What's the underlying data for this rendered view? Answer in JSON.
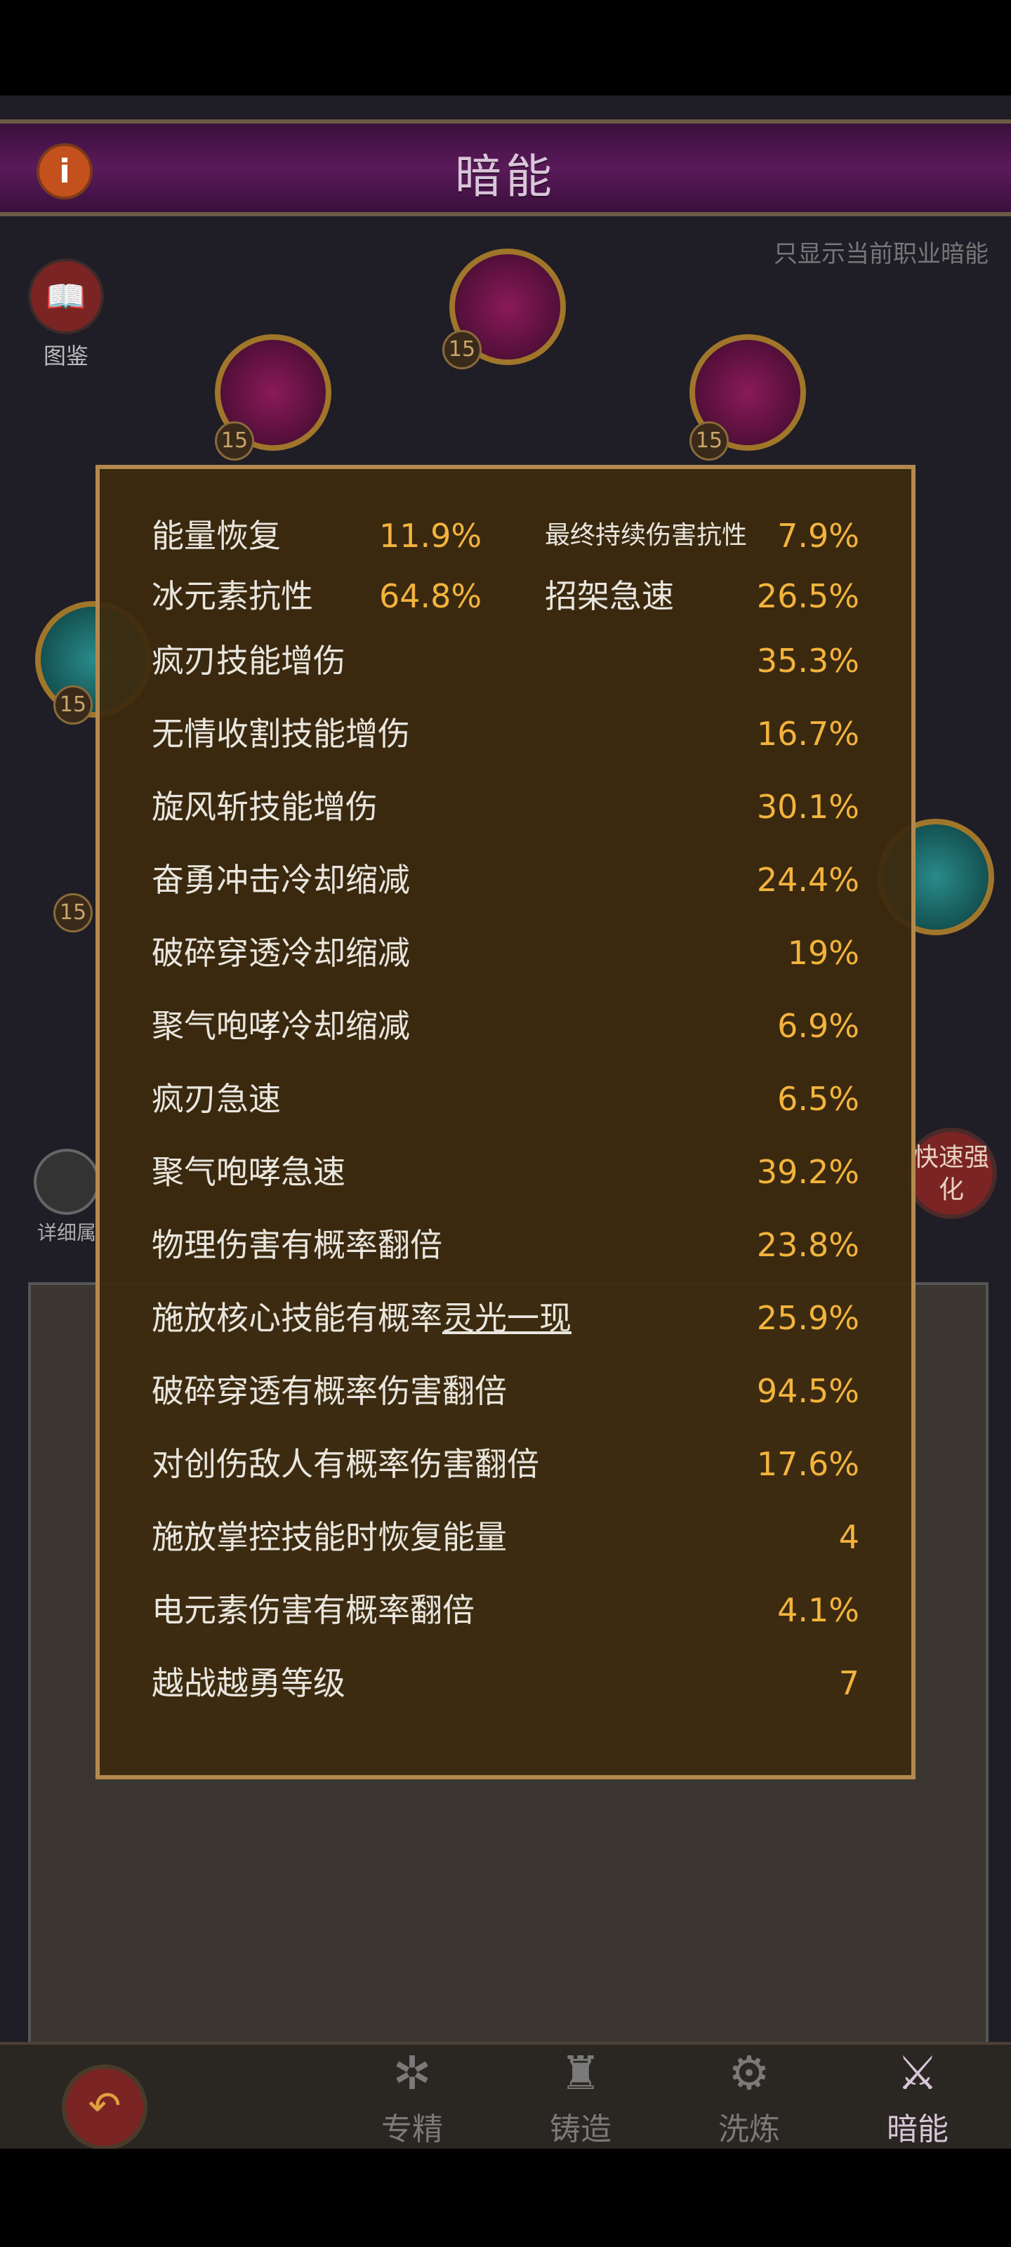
{
  "header": {
    "title": "暗能",
    "info_icon": "i"
  },
  "filter_text": "只显示当前职业暗能",
  "guide_label": "图鉴",
  "detail_label": "详细属",
  "quick_label": "快速强化",
  "node_levels": [
    "15",
    "15",
    "15",
    "15",
    "15"
  ],
  "stats_split": [
    {
      "label1": "能量恢复",
      "value1": "11.9%",
      "label2": "最终持续伤害抗性",
      "value2": "7.9%"
    },
    {
      "label1": "冰元素抗性",
      "value1": "64.8%",
      "label2": "招架急速",
      "value2": "26.5%"
    }
  ],
  "stats": [
    {
      "label": "疯刃技能增伤",
      "value": "35.3%"
    },
    {
      "label": "无情收割技能增伤",
      "value": "16.7%"
    },
    {
      "label": "旋风斩技能增伤",
      "value": "30.1%"
    },
    {
      "label": "奋勇冲击冷却缩减",
      "value": "24.4%"
    },
    {
      "label": "破碎穿透冷却缩减",
      "value": "19%"
    },
    {
      "label": "聚气咆哮冷却缩减",
      "value": "6.9%"
    },
    {
      "label": "疯刃急速",
      "value": "6.5%"
    },
    {
      "label": "聚气咆哮急速",
      "value": "39.2%"
    },
    {
      "label": "物理伤害有概率翻倍",
      "value": "23.8%"
    },
    {
      "label": "施放核心技能有概率",
      "label_link": "灵光一现",
      "value": "25.9%"
    },
    {
      "label": "破碎穿透有概率伤害翻倍",
      "value": "94.5%"
    },
    {
      "label": "对创伤敌人有概率伤害翻倍",
      "value": "17.6%"
    },
    {
      "label": "施放掌控技能时恢复能量",
      "value": "4"
    },
    {
      "label": "电元素伤害有概率翻倍",
      "value": "4.1%"
    },
    {
      "label": "越战越勇等级",
      "value": "7"
    }
  ],
  "nav": [
    {
      "label": "专精",
      "icon": "tree-icon"
    },
    {
      "label": "铸造",
      "icon": "anvil-icon"
    },
    {
      "label": "洗炼",
      "icon": "cube-icon"
    },
    {
      "label": "暗能",
      "icon": "sword-icon"
    }
  ]
}
